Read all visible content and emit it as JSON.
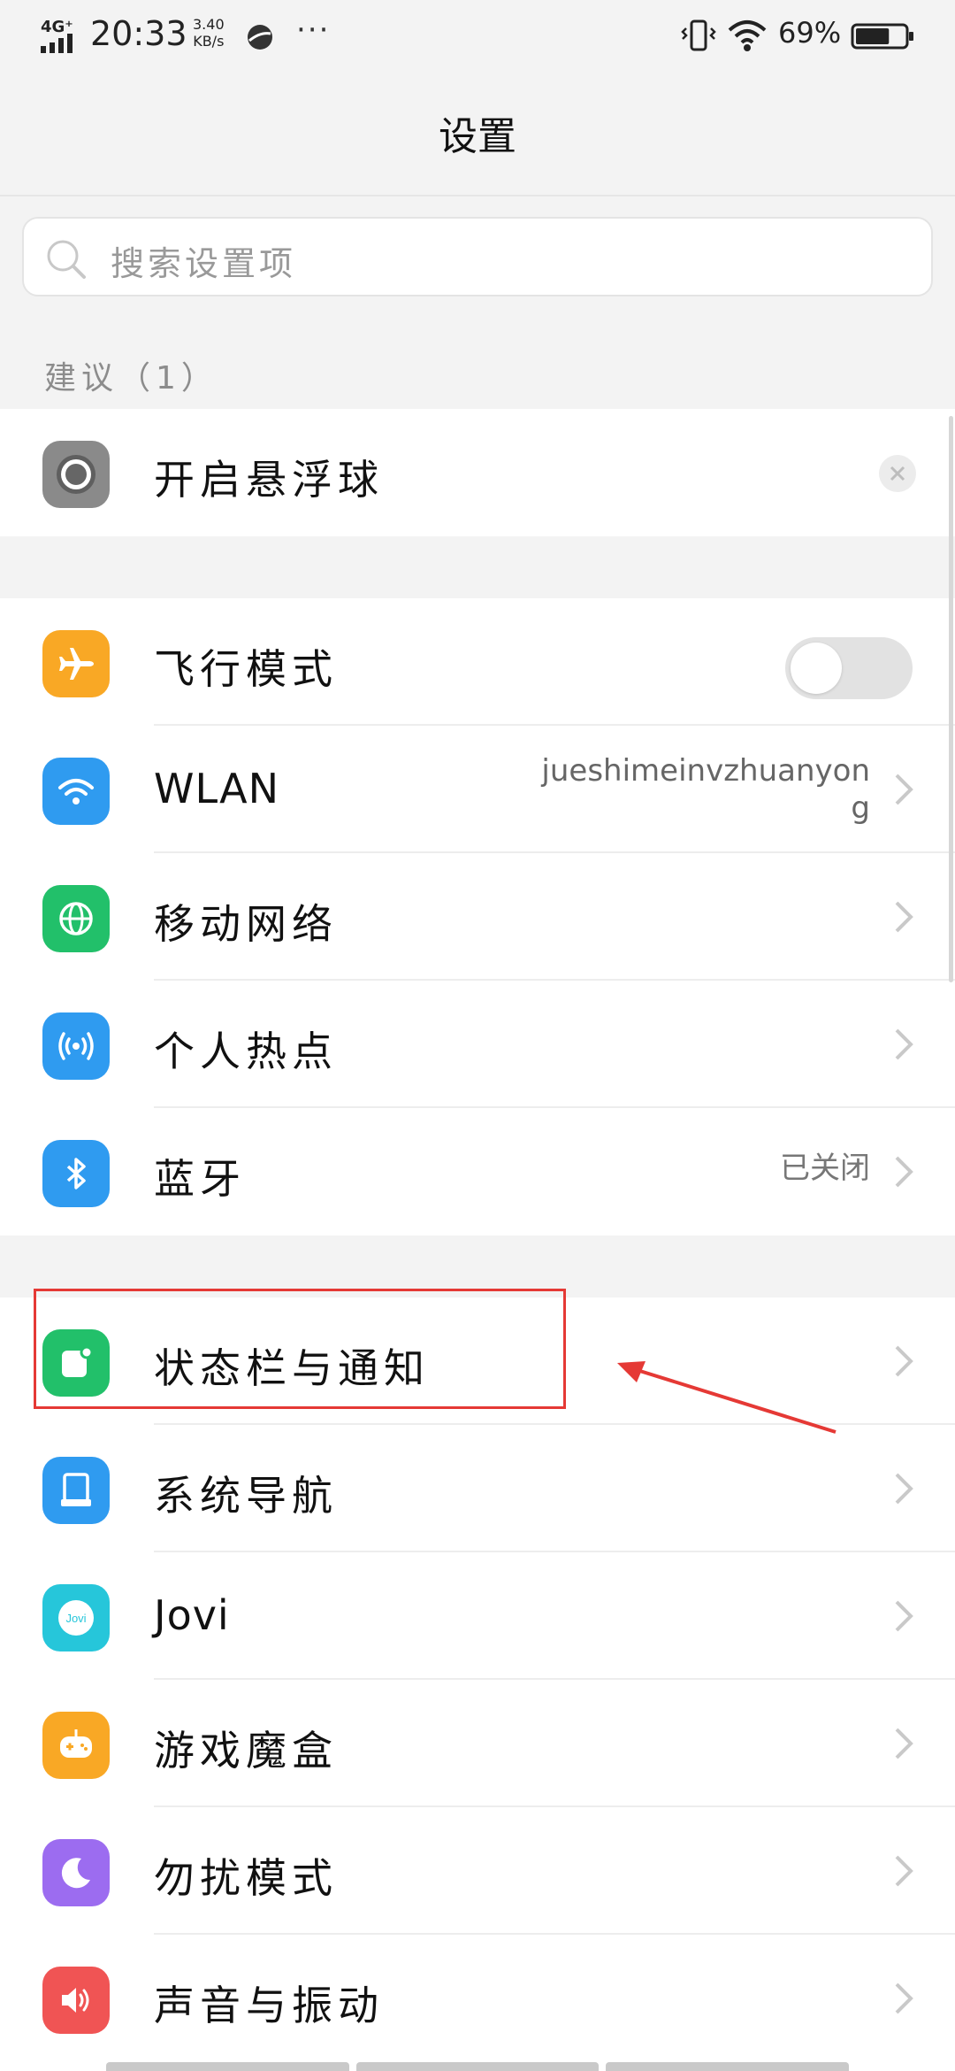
{
  "status_bar": {
    "network": "4G⁺",
    "time": "20:33",
    "speed_value": "3.40",
    "speed_unit": "KB/s",
    "more": "···",
    "battery_percent": "69%",
    "battery_level": 0.69
  },
  "header": {
    "title": "设置"
  },
  "search": {
    "placeholder": "搜索设置项"
  },
  "suggestions": {
    "label": "建议（1）",
    "item": {
      "label": "开启悬浮球",
      "icon": "assistive-ball-icon"
    }
  },
  "group1": [
    {
      "name": "airplane",
      "label": "飞行模式",
      "icon": "airplane-icon",
      "color": "#f9a825",
      "toggle_on": false
    },
    {
      "name": "wlan",
      "label": "WLAN",
      "icon": "wifi-icon",
      "color": "#2f9bf0",
      "value": "jueshimeinvzhuanyong"
    },
    {
      "name": "mobile-network",
      "label": "移动网络",
      "icon": "globe-icon",
      "color": "#22c06a"
    },
    {
      "name": "hotspot",
      "label": "个人热点",
      "icon": "hotspot-icon",
      "color": "#2f9bf0"
    },
    {
      "name": "bluetooth",
      "label": "蓝牙",
      "icon": "bluetooth-icon",
      "color": "#2f9bf0",
      "value": "已关闭"
    }
  ],
  "group2": [
    {
      "name": "status-bar-notifications",
      "label": "状态栏与通知",
      "icon": "notification-icon",
      "color": "#22c06a"
    },
    {
      "name": "system-navigation",
      "label": "系统导航",
      "icon": "navigation-icon",
      "color": "#2f9bf0"
    },
    {
      "name": "jovi",
      "label": "Jovi",
      "icon": "jovi-icon",
      "color": "#26c6da"
    },
    {
      "name": "game-box",
      "label": "游戏魔盒",
      "icon": "gamepad-icon",
      "color": "#f9a825"
    },
    {
      "name": "do-not-disturb",
      "label": "勿扰模式",
      "icon": "moon-icon",
      "color": "#9c6cf0"
    },
    {
      "name": "sound-vibration",
      "label": "声音与振动",
      "icon": "speaker-icon",
      "color": "#f05454"
    }
  ],
  "jovi_badge": "Jovi",
  "annotation": {
    "highlight_color": "#e53935"
  }
}
